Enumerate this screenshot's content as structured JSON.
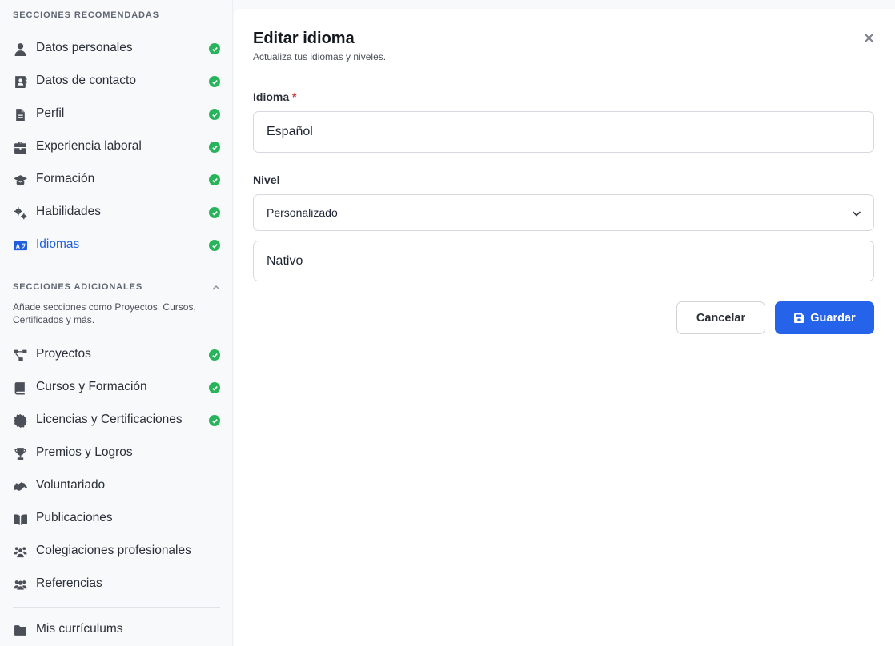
{
  "sidebar": {
    "recommended_title": "SECCIONES RECOMENDADAS",
    "recommended": [
      {
        "label": "Datos personales",
        "icon": "user-icon",
        "done": true
      },
      {
        "label": "Datos de contacto",
        "icon": "contact-card-icon",
        "done": true
      },
      {
        "label": "Perfil",
        "icon": "document-icon",
        "done": true
      },
      {
        "label": "Experiencia laboral",
        "icon": "briefcase-icon",
        "done": true
      },
      {
        "label": "Formación",
        "icon": "graduation-cap-icon",
        "done": true
      },
      {
        "label": "Habilidades",
        "icon": "gears-icon",
        "done": true
      },
      {
        "label": "Idiomas",
        "icon": "language-icon",
        "done": true,
        "active": true
      }
    ],
    "additional_title": "SECCIONES ADICIONALES",
    "additional_desc": "Añade secciones como Proyectos, Cursos, Certificados y más.",
    "additional": [
      {
        "label": "Proyectos",
        "icon": "diagram-icon",
        "done": true
      },
      {
        "label": "Cursos y Formación",
        "icon": "book-icon",
        "done": true
      },
      {
        "label": "Licencias y Certificaciones",
        "icon": "certificate-icon",
        "done": true
      },
      {
        "label": "Premios y Logros",
        "icon": "trophy-icon",
        "done": false
      },
      {
        "label": "Voluntariado",
        "icon": "handshake-icon",
        "done": false
      },
      {
        "label": "Publicaciones",
        "icon": "open-book-icon",
        "done": false
      },
      {
        "label": "Colegiaciones profesionales",
        "icon": "people-group-icon",
        "done": false
      },
      {
        "label": "Referencias",
        "icon": "users-icon",
        "done": false
      }
    ],
    "footer_item": {
      "label": "Mis currículums",
      "icon": "folder-icon"
    }
  },
  "panel": {
    "title": "Editar idioma",
    "subtitle": "Actualiza tus idiomas y niveles.",
    "language_label": "Idioma",
    "required_mark": "*",
    "language_value": "Español",
    "level_label": "Nivel",
    "level_select_value": "Personalizado",
    "custom_level_value": "Nativo",
    "cancel_label": "Cancelar",
    "save_label": "Guardar"
  },
  "colors": {
    "accent": "#2563eb",
    "active_nav": "#1f5fdd",
    "check": "#27b45a",
    "required": "#d63a3a"
  }
}
